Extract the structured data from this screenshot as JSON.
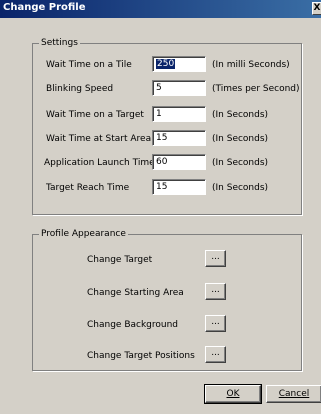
{
  "window": {
    "title": "Change Profile",
    "close_label": "X"
  },
  "settings": {
    "legend": "Settings",
    "rows": [
      {
        "label": "Wait Time on a Tile",
        "value": "250",
        "unit": "(In milli Seconds)"
      },
      {
        "label": "Blinking Speed",
        "value": "5",
        "unit": "(Times per Second)"
      },
      {
        "label": "Wait Time on a Target",
        "value": "1",
        "unit": "(In Seconds)"
      },
      {
        "label": "Wait Time at Start Area",
        "value": "15",
        "unit": "(In Seconds)"
      },
      {
        "label": "Application Launch Time",
        "value": "60",
        "unit": "(In Seconds)"
      },
      {
        "label": "Target Reach Time",
        "value": "15",
        "unit": "(In Seconds)"
      }
    ]
  },
  "appearance": {
    "legend": "Profile Appearance",
    "items": [
      {
        "label": "Change Target",
        "button": "..."
      },
      {
        "label": "Change Starting Area",
        "button": "..."
      },
      {
        "label": "Change Background",
        "button": "..."
      },
      {
        "label": "Change Target Positions",
        "button": "..."
      }
    ]
  },
  "buttons": {
    "ok_label": "OK",
    "cancel_label": "Cancel"
  }
}
